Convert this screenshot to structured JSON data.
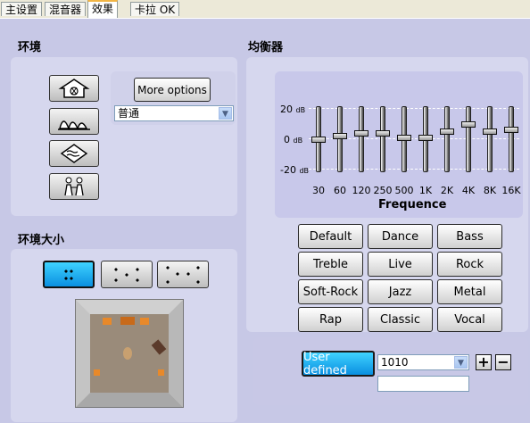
{
  "tabs": [
    {
      "label": "主设置",
      "active": false
    },
    {
      "label": "混音器",
      "active": false
    },
    {
      "label": "效果",
      "active": true
    },
    {
      "label": "卡拉 OK",
      "active": false
    }
  ],
  "environment": {
    "title": "环境",
    "more_options_label": "More options",
    "preset_selected": "普通",
    "icons": [
      "house-music-icon",
      "opera-house-icon",
      "underwater-icon",
      "concert-hall-icon"
    ]
  },
  "environment_size": {
    "title": "环境大小",
    "size_icons": [
      "small-room-icon",
      "medium-room-icon",
      "large-room-icon"
    ],
    "selected_index": 0
  },
  "equalizer": {
    "title": "均衡器",
    "db_labels": {
      "top": "20",
      "mid": "0",
      "bottom": "-20",
      "unit": "dB"
    },
    "bands": [
      {
        "freq": "30",
        "gain": 0
      },
      {
        "freq": "60",
        "gain": 2
      },
      {
        "freq": "120",
        "gain": 4
      },
      {
        "freq": "250",
        "gain": 4
      },
      {
        "freq": "500",
        "gain": 1
      },
      {
        "freq": "1K",
        "gain": 1
      },
      {
        "freq": "2K",
        "gain": 5
      },
      {
        "freq": "4K",
        "gain": 9
      },
      {
        "freq": "8K",
        "gain": 5
      },
      {
        "freq": "16K",
        "gain": 6
      }
    ],
    "axis_label": "Frequence",
    "presets": [
      "Default",
      "Dance",
      "Bass",
      "Treble",
      "Live",
      "Rock",
      "Soft-Rock",
      "Jazz",
      "Metal",
      "Rap",
      "Classic",
      "Vocal"
    ],
    "user_defined_label": "User defined",
    "user_preset_value": "1010",
    "user_name_value": "",
    "add_label": "+",
    "remove_label": "−"
  },
  "colors": {
    "accent_blue": "#0a8fe0",
    "background": "#c7c8e6"
  }
}
